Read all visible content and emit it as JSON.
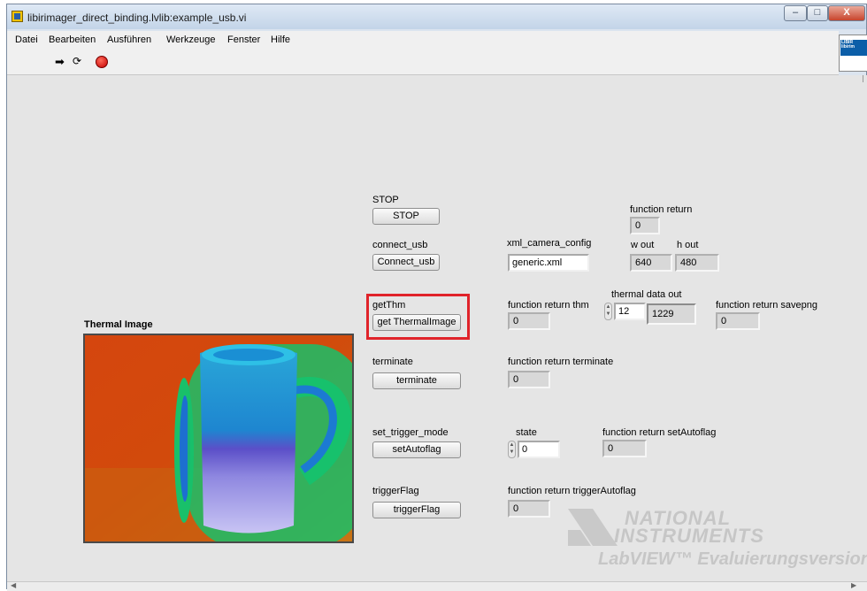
{
  "window": {
    "title": "libirimager_direct_binding.lvlib:example_usb.vi",
    "controls": {
      "minimize": "–",
      "maximize": "□",
      "close": "X"
    }
  },
  "menu": [
    "Datei",
    "Bearbeiten",
    "Ausführen",
    "Werkzeuge",
    "Fenster",
    "Hilfe"
  ],
  "toolbar": {
    "run_icon": "run-arrow-icon",
    "continuous_icon": "run-continuously-icon",
    "abort_icon": "abort-execution-icon"
  },
  "vi_icon": {
    "text": "LIBIR\nlibirim"
  },
  "thermal_image": {
    "label": "Thermal Image"
  },
  "controls": {
    "stop": {
      "label": "STOP",
      "button": "STOP"
    },
    "connect": {
      "label": "connect_usb",
      "button": "Connect_usb"
    },
    "getthm": {
      "label": "getThm",
      "button": "get ThermalImage"
    },
    "terminate": {
      "label": "terminate",
      "button": "terminate"
    },
    "trigger_mode": {
      "label": "set_trigger_mode",
      "button": "setAutoflag"
    },
    "trigger_flag": {
      "label": "triggerFlag",
      "button": "triggerFlag"
    }
  },
  "fields": {
    "function_return": {
      "label": "function return",
      "value": "0"
    },
    "xml_config": {
      "label": "xml_camera_config",
      "value": "generic.xml"
    },
    "w_out": {
      "label": "w out",
      "value": "640"
    },
    "h_out": {
      "label": "h out",
      "value": "480"
    },
    "return_thm": {
      "label": "function return thm",
      "value": "0"
    },
    "thermal_data": {
      "label": "thermal data out",
      "index": "12",
      "value": "1229"
    },
    "return_savepng": {
      "label": "function return savepng",
      "value": "0"
    },
    "return_terminate": {
      "label": "function return terminate",
      "value": "0"
    },
    "state": {
      "label": "state",
      "value": "0"
    },
    "return_setautoflag": {
      "label": "function return setAutoflag",
      "value": "0"
    },
    "return_triggerautoflag": {
      "label": "function return triggerAutoflag",
      "value": "0"
    }
  },
  "watermark": {
    "line1": "NATIONAL",
    "line2": "INSTRUMENTS",
    "line3": "LabVIEW™ Evaluierungsversion"
  },
  "colors": {
    "highlight": "#e0232a",
    "panel": "#e5e5e5",
    "abort": "#c40000"
  }
}
